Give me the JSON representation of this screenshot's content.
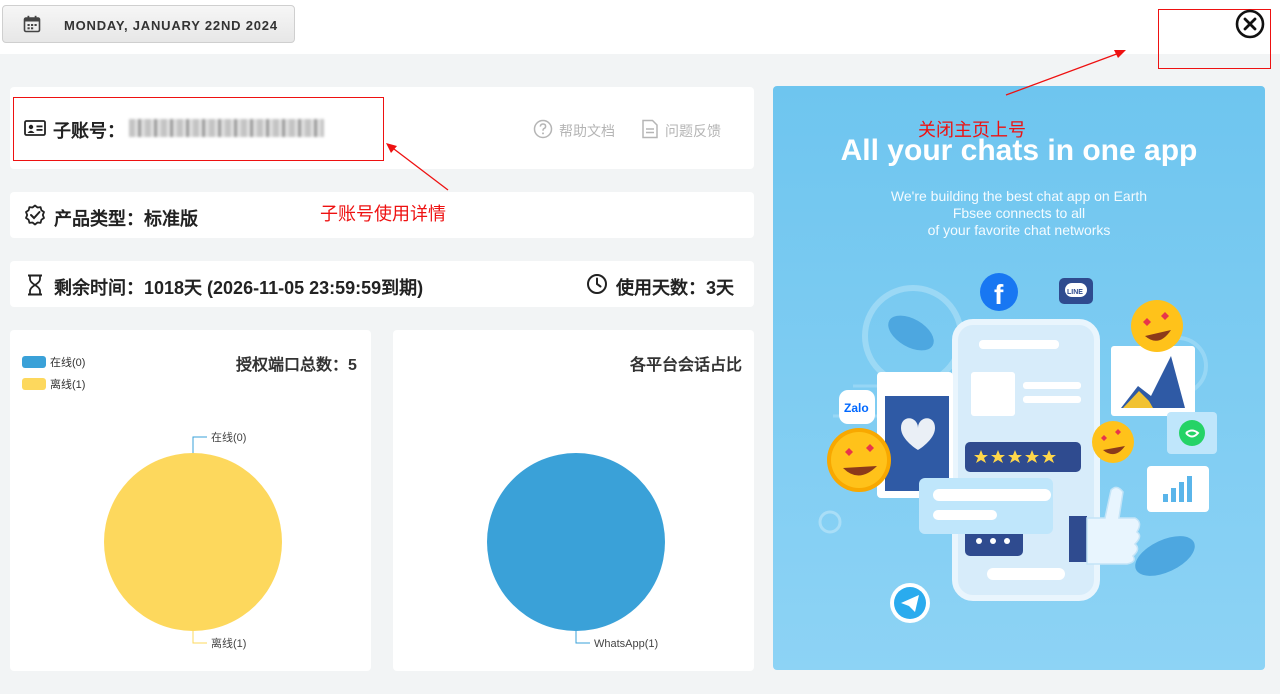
{
  "header": {
    "date": "MONDAY, JANUARY 22ND 2024",
    "calendar_icon": "calendar-icon",
    "close_icon": "close-circle-icon"
  },
  "account": {
    "label": "子账号：",
    "value": "████████████████",
    "help_label": "帮助文档",
    "feedback_label": "问题反馈"
  },
  "product": {
    "text": "产品类型：标准版"
  },
  "time": {
    "remaining": "剩余时间：1018天 (2026-11-05 23:59:59到期)",
    "days_used": "使用天数：3天"
  },
  "chart_ports": {
    "title": "授权端口总数：5",
    "legend": [
      {
        "label": "在线(0)",
        "color": "#3aa1d8"
      },
      {
        "label": "离线(1)",
        "color": "#fdd85d"
      }
    ]
  },
  "chart_platforms": {
    "title": "各平台会话占比"
  },
  "promo": {
    "headline": "All your chats in one app",
    "line1": "We're building the best chat app on Earth",
    "line2": "Fbsee connects to all",
    "line3": "of your favorite chat networks"
  },
  "annotations": {
    "close": "关闭主页上号",
    "account": "子账号使用详情"
  },
  "chart_data": [
    {
      "type": "pie",
      "title": "授权端口总数：5",
      "categories": [
        "在线(0)",
        "离线(1)"
      ],
      "values": [
        0,
        1
      ],
      "colors": [
        "#3aa1d8",
        "#fdd85d"
      ],
      "legend": "top-left"
    },
    {
      "type": "pie",
      "title": "各平台会话占比",
      "categories": [
        "WhatsApp(1)"
      ],
      "values": [
        1
      ],
      "colors": [
        "#3aa1d8"
      ]
    }
  ]
}
